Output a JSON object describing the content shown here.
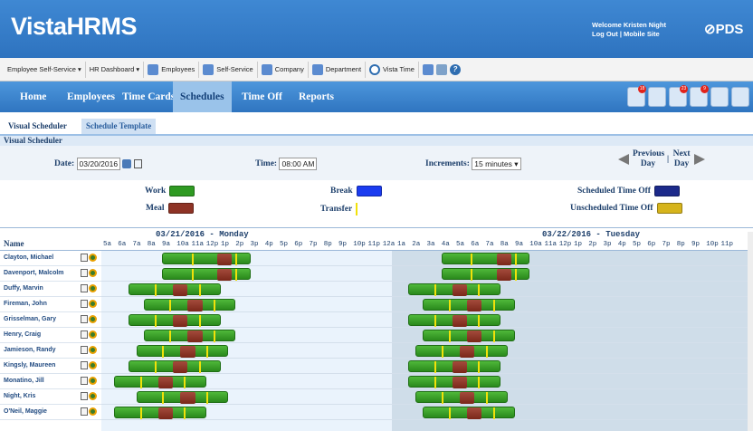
{
  "app": {
    "logo": "VistaHRMS",
    "welcome": "Welcome Kristen Night",
    "logout": "Log Out",
    "mobile": "Mobile Site",
    "brand": "PDS"
  },
  "toolbar": {
    "items": [
      "Employee Self-Service ▾",
      "HR Dashboard ▾",
      "Employees",
      "Self-Service",
      "Company",
      "Department",
      "Vista Time"
    ]
  },
  "nav": {
    "items": [
      "Home",
      "Employees",
      "Time Cards",
      "Schedules",
      "Time Off",
      "Reports"
    ],
    "active": "Schedules",
    "badges": [
      "18",
      "4",
      "23",
      "9"
    ]
  },
  "subtabs": [
    "Visual Scheduler",
    "Schedule Template"
  ],
  "section_title": "Visual Scheduler",
  "controls": {
    "date_label": "Date:",
    "date_value": "03/20/2016",
    "time_label": "Time:",
    "time_value": "08:00 AM",
    "increments_label": "Increments:",
    "increments_value": "15 minutes ▾",
    "previous_day": "Previous Day",
    "next_day": "Next Day"
  },
  "legend": {
    "work": "Work",
    "meal": "Meal",
    "break": "Break",
    "transfer": "Transfer",
    "scheduled_off": "Scheduled Time Off",
    "unscheduled_off": "Unscheduled Time Off",
    "colors": {
      "work": "#2f9a22",
      "meal": "#8e3325",
      "break": "#1b3cf0",
      "transfer": "#f1e10a",
      "scheduled_off": "#1c2a8a",
      "unscheduled_off": "#d6b41c"
    }
  },
  "grid": {
    "name_header": "Name",
    "days": [
      "03/21/2016 - Monday",
      "03/22/2016 - Tuesday"
    ],
    "hours": [
      "5a",
      "6a",
      "7a",
      "8a",
      "9a",
      "10a",
      "11a",
      "12p",
      "1p",
      "2p",
      "3p",
      "4p",
      "5p",
      "6p",
      "7p",
      "8p",
      "9p",
      "10p",
      "11p",
      "12a",
      "1a",
      "2a",
      "3a",
      "4a",
      "5a",
      "6a",
      "7a",
      "8a",
      "9a",
      "10a",
      "11a",
      "12p",
      "1p",
      "2p",
      "3p",
      "4p",
      "5p",
      "6p",
      "7p",
      "8p",
      "9p",
      "10p",
      "11p"
    ],
    "employees": [
      {
        "name": "Clayton, Michael",
        "d1": {
          "start": 9.0,
          "end": 15.0,
          "meal": 12.75,
          "breaks": [
            11.0,
            14.0
          ]
        },
        "d2": {
          "start": 9.0,
          "end": 15.0,
          "meal": 12.75,
          "breaks": [
            11.0,
            14.0
          ]
        }
      },
      {
        "name": "Davenport, Malcolm",
        "d1": {
          "start": 9.0,
          "end": 15.0,
          "meal": 12.75,
          "breaks": [
            11.0,
            14.0
          ]
        },
        "d2": {
          "start": 9.0,
          "end": 15.0,
          "meal": 12.75,
          "breaks": [
            11.0,
            14.0
          ]
        }
      },
      {
        "name": "Duffy, Marvin",
        "d1": {
          "start": 6.75,
          "end": 13.0,
          "meal": 9.75,
          "breaks": [
            8.5,
            11.5
          ]
        },
        "d2": {
          "start": 6.75,
          "end": 13.0,
          "meal": 9.75,
          "breaks": [
            8.5,
            11.5
          ]
        }
      },
      {
        "name": "Fireman, John",
        "d1": {
          "start": 7.75,
          "end": 14.0,
          "meal": 10.75,
          "breaks": [
            9.5,
            12.5
          ]
        },
        "d2": {
          "start": 7.75,
          "end": 14.0,
          "meal": 10.75,
          "breaks": [
            9.5,
            12.5
          ]
        }
      },
      {
        "name": "Grisselman, Gary",
        "d1": {
          "start": 6.75,
          "end": 13.0,
          "meal": 9.75,
          "breaks": [
            8.5,
            11.5
          ]
        },
        "d2": {
          "start": 6.75,
          "end": 13.0,
          "meal": 9.75,
          "breaks": [
            8.5,
            11.5
          ]
        }
      },
      {
        "name": "Henry, Craig",
        "d1": {
          "start": 7.75,
          "end": 14.0,
          "meal": 10.75,
          "breaks": [
            9.5,
            12.5
          ]
        },
        "d2": {
          "start": 7.75,
          "end": 14.0,
          "meal": 10.75,
          "breaks": [
            9.5,
            12.5
          ]
        }
      },
      {
        "name": "Jamieson, Randy",
        "d1": {
          "start": 7.25,
          "end": 13.5,
          "meal": 10.25,
          "breaks": [
            9.0,
            12.0
          ]
        },
        "d2": {
          "start": 7.25,
          "end": 13.5,
          "meal": 10.25,
          "breaks": [
            9.0,
            12.0
          ]
        }
      },
      {
        "name": "Kingsly, Maureen",
        "d1": {
          "start": 6.75,
          "end": 13.0,
          "meal": 9.75,
          "breaks": [
            8.5,
            11.5
          ]
        },
        "d2": {
          "start": 6.75,
          "end": 13.0,
          "meal": 9.75,
          "breaks": [
            8.5,
            11.5
          ]
        }
      },
      {
        "name": "Monatino, Jill",
        "d1": {
          "start": 5.75,
          "end": 12.0,
          "meal": 8.75,
          "breaks": [
            7.5,
            10.5
          ]
        },
        "d2": {
          "start": 6.75,
          "end": 13.0,
          "meal": 9.75,
          "breaks": [
            8.5,
            11.5
          ]
        }
      },
      {
        "name": "Night, Kris",
        "d1": {
          "start": 7.25,
          "end": 13.5,
          "meal": 10.25,
          "breaks": [
            9.0,
            12.0
          ]
        },
        "d2": {
          "start": 7.25,
          "end": 13.5,
          "meal": 10.25,
          "breaks": [
            9.0,
            12.0
          ]
        }
      },
      {
        "name": "O'Neil, Maggie",
        "d1": {
          "start": 5.75,
          "end": 12.0,
          "meal": 8.75,
          "breaks": [
            7.5,
            10.5
          ]
        },
        "d2": {
          "start": 7.75,
          "end": 14.0,
          "meal": 10.75,
          "breaks": [
            9.5,
            12.5
          ]
        }
      }
    ]
  }
}
